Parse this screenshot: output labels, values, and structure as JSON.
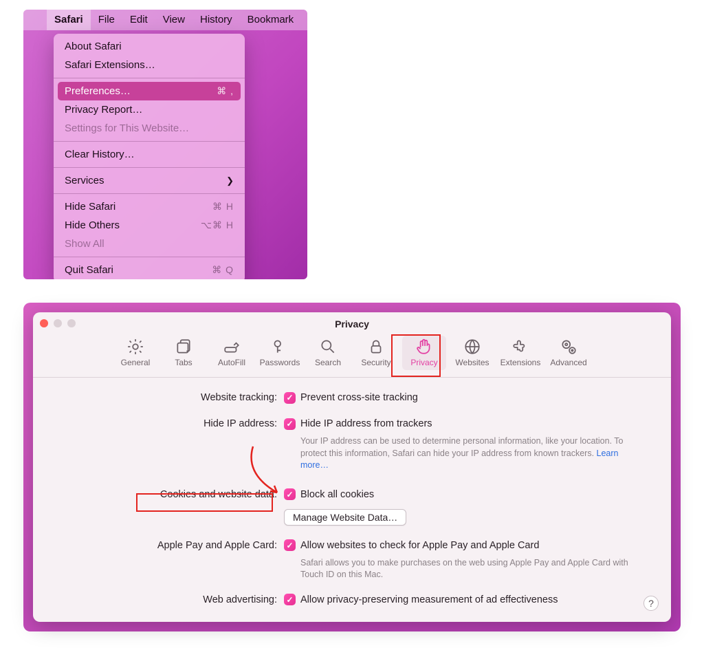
{
  "menubar": {
    "items": [
      "Safari",
      "File",
      "Edit",
      "View",
      "History",
      "Bookmark"
    ],
    "active_index": 0
  },
  "dropdown": {
    "about": "About Safari",
    "extensions": "Safari Extensions…",
    "preferences": {
      "label": "Preferences…",
      "shortcut": "⌘ ,"
    },
    "privacy_report": "Privacy Report…",
    "settings_site": "Settings for This Website…",
    "clear_history": "Clear History…",
    "services": "Services",
    "hide_safari": {
      "label": "Hide Safari",
      "shortcut": "⌘ H"
    },
    "hide_others": {
      "label": "Hide Others",
      "shortcut": "⌥⌘ H"
    },
    "show_all": "Show All",
    "quit": {
      "label": "Quit Safari",
      "shortcut": "⌘ Q"
    }
  },
  "prefs": {
    "title": "Privacy",
    "tabs": [
      "General",
      "Tabs",
      "AutoFill",
      "Passwords",
      "Search",
      "Security",
      "Privacy",
      "Websites",
      "Extensions",
      "Advanced"
    ],
    "active_tab": "Privacy",
    "website_tracking": {
      "label": "Website tracking:",
      "option": "Prevent cross-site tracking"
    },
    "hide_ip": {
      "label": "Hide IP address:",
      "option": "Hide IP address from trackers",
      "desc": "Your IP address can be used to determine personal information, like your location. To protect this information, Safari can hide your IP address from known trackers. ",
      "learn": "Learn more…"
    },
    "cookies": {
      "label": "Cookies and website data:",
      "option": "Block all cookies",
      "manage": "Manage Website Data…"
    },
    "apple_pay": {
      "label": "Apple Pay and Apple Card:",
      "option": "Allow websites to check for Apple Pay and Apple Card",
      "desc": "Safari allows you to make purchases on the web using Apple Pay and Apple Card with Touch ID on this Mac."
    },
    "web_ads": {
      "label": "Web advertising:",
      "option": "Allow privacy-preserving measurement of ad effectiveness"
    },
    "help": "?"
  }
}
